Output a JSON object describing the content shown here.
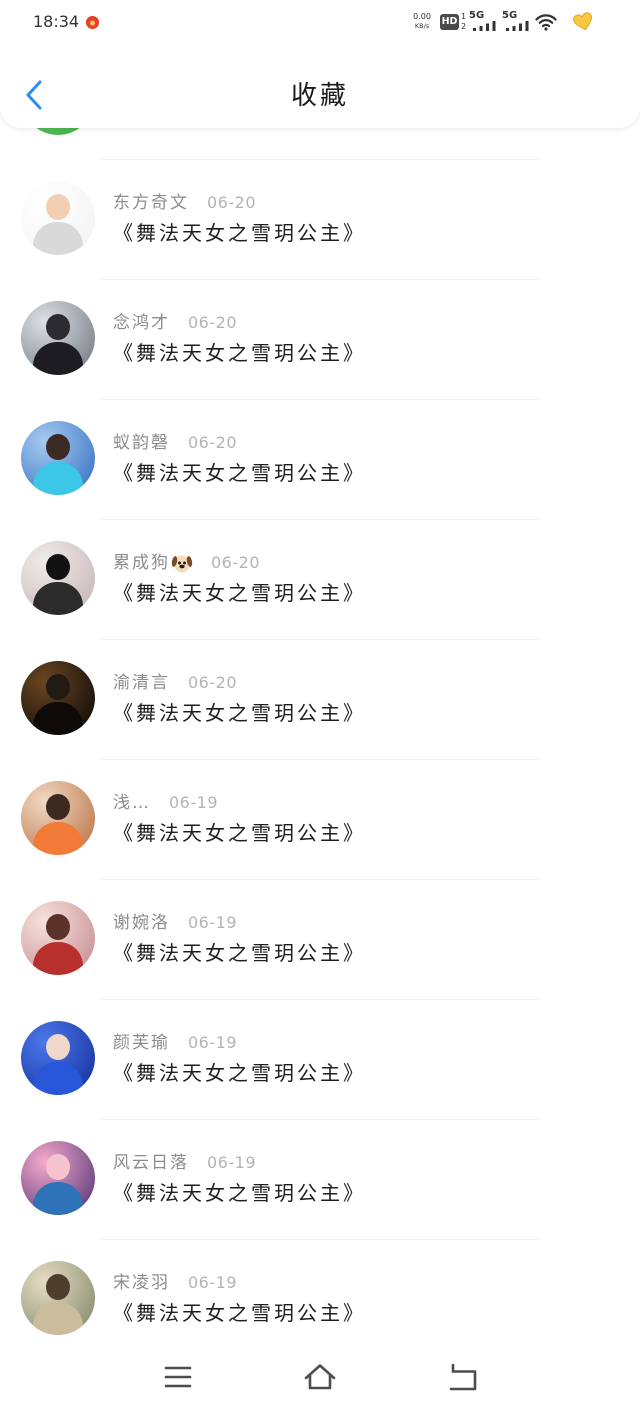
{
  "status_bar": {
    "time": "18:34",
    "notification_icon": "app-notification-icon",
    "net_speed": "0.00",
    "net_speed_unit": "KB/s",
    "hd_label": "HD",
    "sim_top": "1",
    "sim_bottom": "2",
    "network_1": "5G",
    "network_2": "5G",
    "signal_icon": "signal-bars-icon",
    "wifi_icon": "wifi-icon",
    "battery_icon": "heart-icon"
  },
  "header": {
    "title": "收藏",
    "back_icon": "chevron-left-icon"
  },
  "colors": {
    "accent": "#2b8ef0",
    "name_text": "#8c8c8c",
    "date_text": "#b3b3b3",
    "title_text": "#1e1e1e",
    "divider": "#f0f0f0",
    "nav_icon": "#4d4d4d",
    "heart": "#f6c744"
  },
  "partial_item": {
    "avatar": {
      "bg": [
        "#6fd06a",
        "#3fae45"
      ]
    }
  },
  "items": [
    {
      "name": "东方奇文",
      "date": "06-20",
      "title": "《舞法天女之雪玥公主》",
      "avatar": {
        "bg": [
          "#ffffff",
          "#f2f2f2"
        ],
        "head": "#f2cfb2",
        "body": "#d9d9d9"
      }
    },
    {
      "name": "念鸿才",
      "date": "06-20",
      "title": "《舞法天女之雪玥公主》",
      "avatar": {
        "bg": [
          "#dde1e6",
          "#6b7079"
        ],
        "head": "#2b2b30",
        "body": "#1c1c21"
      }
    },
    {
      "name": "蚁韵磬",
      "date": "06-20",
      "title": "《舞法天女之雪玥公主》",
      "avatar": {
        "bg": [
          "#a7cbef",
          "#2c69c0"
        ],
        "head": "#3b2b24",
        "body": "#3cc6e8"
      }
    },
    {
      "name": "累成狗",
      "name_emoji": "🐶",
      "date": "06-20",
      "title": "《舞法天女之雪玥公主》",
      "avatar": {
        "bg": [
          "#f1ebeb",
          "#c3b1b1"
        ],
        "head": "#121212",
        "body": "#2b2b2b"
      }
    },
    {
      "name": "渝清言",
      "date": "06-20",
      "title": "《舞法天女之雪玥公主》",
      "avatar": {
        "bg": [
          "#6b4522",
          "#050505"
        ],
        "head": "#221a15",
        "body": "#0d0a08"
      }
    },
    {
      "name": "浅…",
      "date": "06-19",
      "title": "《舞法天女之雪玥公主》",
      "avatar": {
        "bg": [
          "#f2d9c4",
          "#b56a3c"
        ],
        "head": "#3c2a20",
        "body": "#f27a38"
      }
    },
    {
      "name": "谢婉洛",
      "date": "06-19",
      "title": "《舞法天女之雪玥公主》",
      "avatar": {
        "bg": [
          "#f7e3dd",
          "#c2848a"
        ],
        "head": "#5b3128",
        "body": "#b8302c"
      }
    },
    {
      "name": "颜芙瑜",
      "date": "06-19",
      "title": "《舞法天女之雪玥公主》",
      "avatar": {
        "bg": [
          "#4a78ea",
          "#132b96"
        ],
        "head": "#f1d6cb",
        "body": "#2756d8"
      }
    },
    {
      "name": "风云日落",
      "date": "06-19",
      "title": "《舞法天女之雪玥公主》",
      "avatar": {
        "bg": [
          "#f3aacb",
          "#4a2c72"
        ],
        "head": "#f5c2cf",
        "body": "#2e73b8"
      }
    },
    {
      "name": "宋凌羽",
      "date": "06-19",
      "title": "《舞法天女之雪玥公主》",
      "avatar": {
        "bg": [
          "#e6ddc4",
          "#7b8264"
        ],
        "head": "#4f3d2d",
        "body": "#cbbd9c"
      }
    }
  ],
  "nav": {
    "menu_icon": "menu-icon",
    "home_icon": "home-icon",
    "back_icon": "back-icon"
  }
}
